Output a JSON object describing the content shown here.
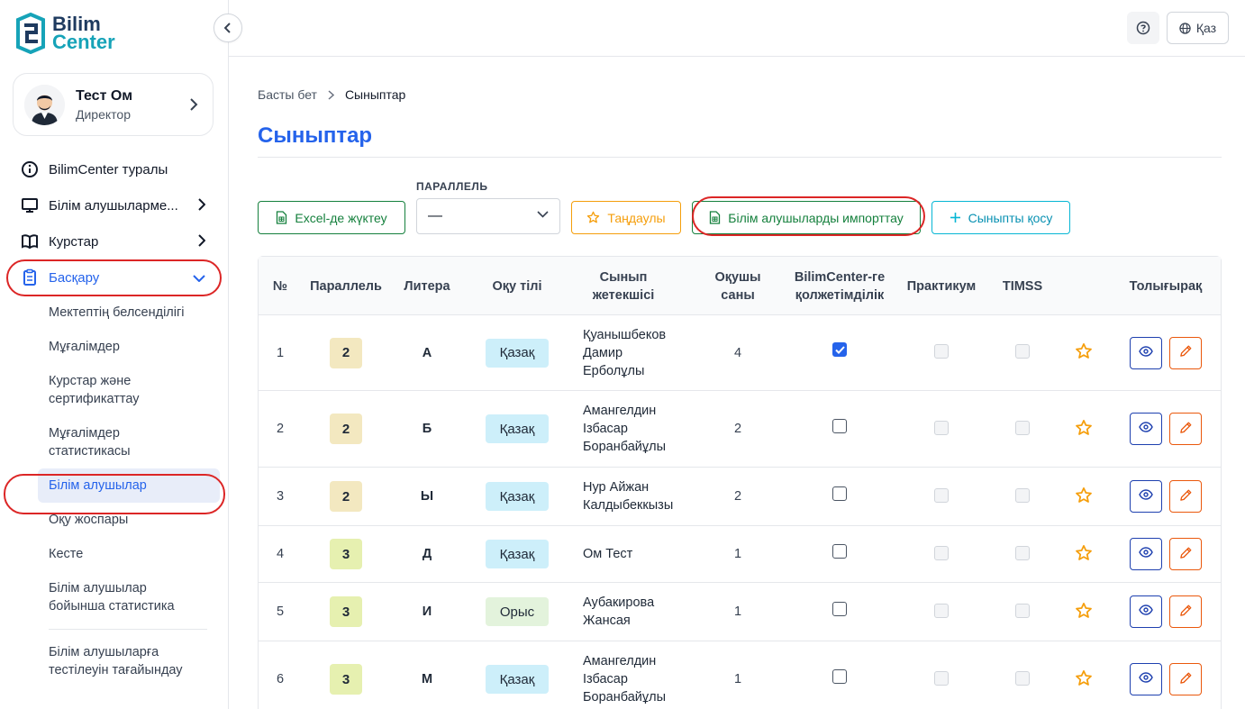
{
  "app": {
    "logo_line1": "Bilim",
    "logo_line2": "Center"
  },
  "profile": {
    "name": "Тест Ом",
    "role": "Директор"
  },
  "nav": {
    "about": "BilimCenter туралы",
    "students_mgmt": "Білім алушыларме...",
    "courses": "Курстар",
    "admin": "Басқару",
    "sub": [
      "Мектептің белсенділігі",
      "Мұғалімдер",
      "Курстар және сертификаттау",
      "Мұғалімдер статистикасы",
      "Білім алушылар",
      "Оқу жоспары",
      "Кесте",
      "Білім алушылар бойынша статистика",
      "Білім алушыларға тестілеуін тағайындау"
    ]
  },
  "topbar": {
    "lang": "Қаз"
  },
  "breadcrumb": {
    "home": "Басты бет",
    "current": "Сыныптар"
  },
  "page_title": "Сыныптар",
  "toolbar": {
    "excel": "Excel-де жүктеу",
    "filter_label": "ПАРАЛЛЕЛЬ",
    "filter_value": "—",
    "favorites": "Таңдаулы",
    "import": "Білім алушыларды импорттау",
    "add_class": "Сыныпты қосу"
  },
  "table": {
    "headers": {
      "num": "№",
      "parallel": "Параллель",
      "litera": "Литера",
      "lang": "Оқу тілі",
      "teacher": "Сынып жетекшісі",
      "count": "Оқушы саны",
      "access": "BilimCenter-ге қолжетімділік",
      "practicum": "Практикум",
      "timss": "TIMSS",
      "more": "Толығырақ"
    },
    "rows": [
      {
        "num": "1",
        "parallel": "2",
        "litera": "А",
        "lang": "Қазақ",
        "teacher": "Қуанышбеков Дамир Ерболұлы",
        "count": "4",
        "access": true
      },
      {
        "num": "2",
        "parallel": "2",
        "litera": "Б",
        "lang": "Қазақ",
        "teacher": "Амангелдин Ізбасар Боранбайұлы",
        "count": "2",
        "access": false
      },
      {
        "num": "3",
        "parallel": "2",
        "litera": "Ы",
        "lang": "Қазақ",
        "teacher": "Нур Айжан Калдыбеккызы",
        "count": "2",
        "access": false
      },
      {
        "num": "4",
        "parallel": "3",
        "litera": "Д",
        "lang": "Қазақ",
        "teacher": "Ом Тест",
        "count": "1",
        "access": false
      },
      {
        "num": "5",
        "parallel": "3",
        "litera": "И",
        "lang": "Орыс",
        "teacher": "Аубакирова Жансая",
        "count": "1",
        "access": false
      },
      {
        "num": "6",
        "parallel": "3",
        "litera": "М",
        "lang": "Қазақ",
        "teacher": "Амангелдин Ізбасар Боранбайұлы",
        "count": "1",
        "access": false
      }
    ]
  },
  "colors": {
    "primary": "#2563eb",
    "green": "#15803d",
    "amber": "#f59e0b",
    "cyan": "#06b6d4",
    "badge_yellow": "#f3e8c0",
    "badge_lime": "#e6f0b0",
    "lang_kaz": "#cdeffa",
    "lang_rus": "#e3f3dc",
    "annotation": "#dc2626"
  }
}
